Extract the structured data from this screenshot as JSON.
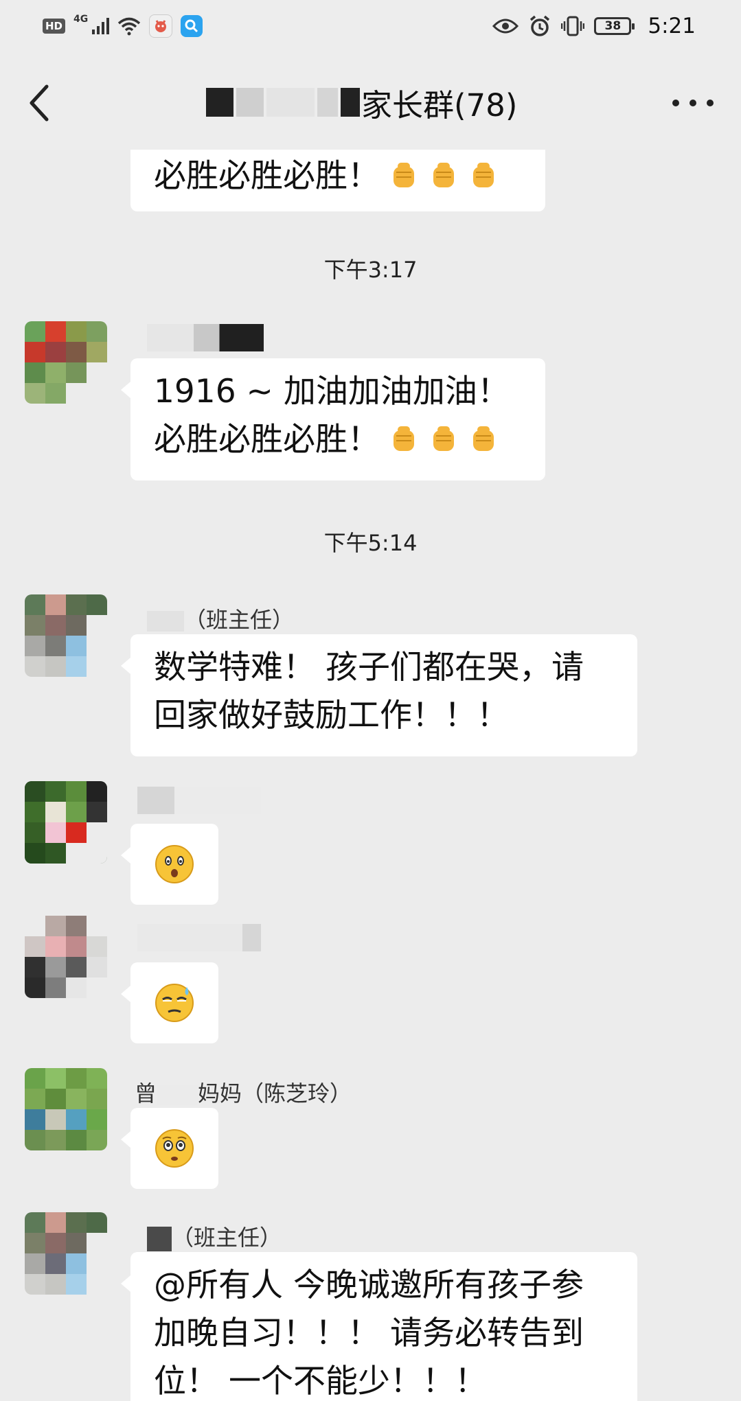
{
  "status_bar": {
    "hd": "HD",
    "network": "4G",
    "battery": "38",
    "time": "5:21",
    "icons": [
      "signal-icon",
      "wifi-icon",
      "app-icon",
      "search-app-icon",
      "eye-icon",
      "alarm-icon",
      "vibrate-icon",
      "battery-icon"
    ]
  },
  "header": {
    "title": "家长群(78)",
    "back_icon": "back-chevron-icon",
    "more_icon": "more-dots-icon"
  },
  "messages": [
    {
      "type": "text",
      "lines": [
        "必胜必胜必胜！"
      ],
      "emoji_count": 3,
      "emoji": "fist-emoji"
    },
    {
      "type": "timestamp",
      "text": "下午3:17"
    },
    {
      "type": "text",
      "sender": "",
      "lines": [
        "1916 ~ 加油加油加油！",
        "必胜必胜必胜！"
      ],
      "emoji_count": 3,
      "emoji": "fist-emoji"
    },
    {
      "type": "timestamp",
      "text": "下午5:14"
    },
    {
      "type": "text",
      "sender": "（班主任）",
      "lines": [
        "数学特难！ 孩子们都在哭，请",
        "回家做好鼓励工作！！！"
      ]
    },
    {
      "type": "emoji",
      "sender": "",
      "emoji": "surprised-face-emoji"
    },
    {
      "type": "emoji",
      "sender": "",
      "emoji": "sweat-face-emoji"
    },
    {
      "type": "emoji",
      "sender_prefix": "曾",
      "sender": "妈妈（陈芝玲）",
      "emoji": "worried-face-emoji"
    },
    {
      "type": "text",
      "sender": "（班主任）",
      "lines": [
        "@所有人  今晚诚邀所有孩子参",
        "加晚自习！！！ 请务必转告到",
        "位！ 一个不能少！！！"
      ]
    }
  ],
  "colors": {
    "background": "#ececec",
    "bubble": "#ffffff",
    "text": "#111111"
  }
}
